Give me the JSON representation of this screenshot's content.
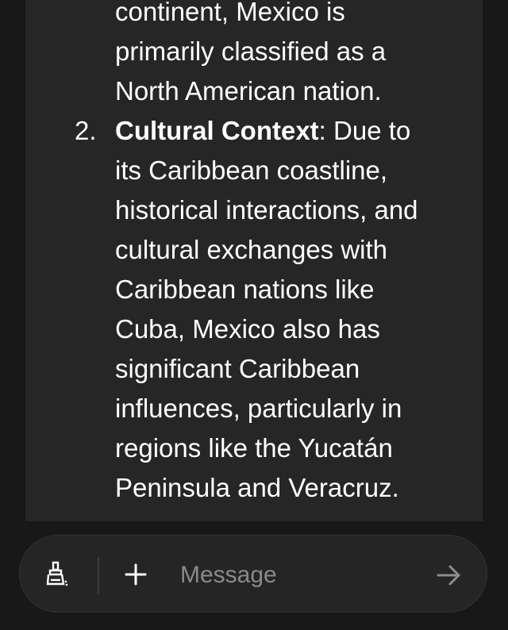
{
  "message": {
    "continuation_lines": [
      "continent, Mexico is",
      "primarily classified as a",
      "North American nation."
    ],
    "item": {
      "number": "2.",
      "title": "Cultural Context",
      "first_line_rest": ": Due to",
      "lines": [
        "its Caribbean coastline,",
        "historical interactions, and",
        "cultural exchanges with",
        "Caribbean nations like",
        "Cuba, Mexico also has",
        "significant Caribbean",
        "influences, particularly in",
        "regions like the Yucatán",
        "Peninsula and Veracruz."
      ]
    }
  },
  "composer": {
    "placeholder": "Message",
    "value": "",
    "icons": {
      "left": "brush-icon",
      "add": "plus-icon",
      "send": "arrow-right-icon"
    }
  },
  "colors": {
    "background": "#181818",
    "message_card": "#262626",
    "composer": "#252525",
    "text": "#ffffff",
    "placeholder": "#8a8a8a"
  }
}
